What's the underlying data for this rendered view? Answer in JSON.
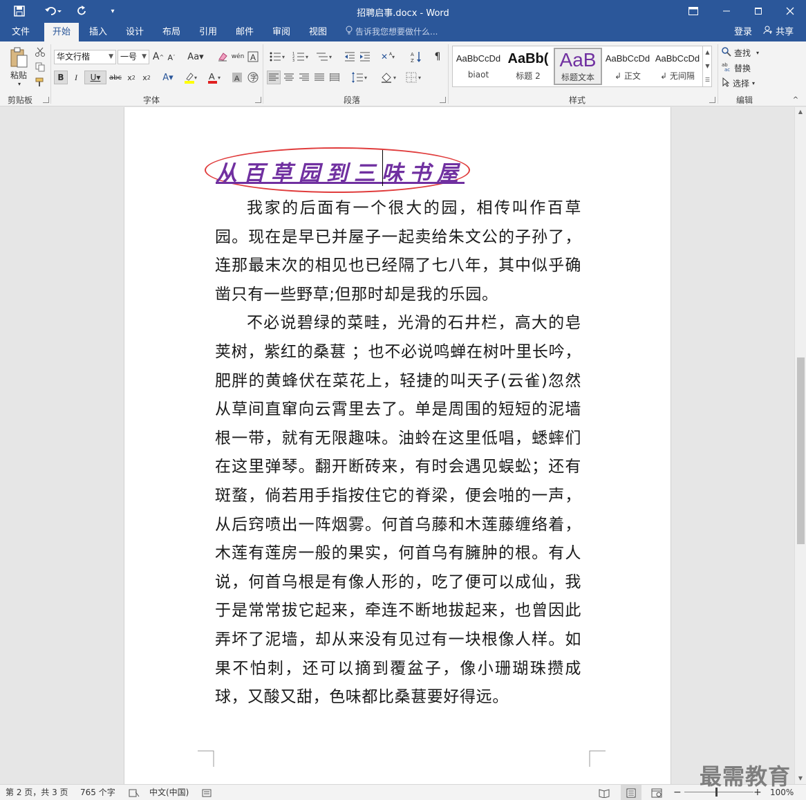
{
  "window": {
    "title": "招聘启事.docx - Word"
  },
  "tabs": [
    {
      "label": "文件"
    },
    {
      "label": "开始",
      "active": true
    },
    {
      "label": "插入"
    },
    {
      "label": "设计"
    },
    {
      "label": "布局"
    },
    {
      "label": "引用"
    },
    {
      "label": "邮件"
    },
    {
      "label": "审阅"
    },
    {
      "label": "视图"
    }
  ],
  "tellme": "告诉我您想要做什么...",
  "account": {
    "login": "登录",
    "share": "共享"
  },
  "ribbon": {
    "clipboard": {
      "paste": "粘贴",
      "label": "剪贴板"
    },
    "font": {
      "name": "华文行楷",
      "size": "一号",
      "label": "字体"
    },
    "paragraph": {
      "label": "段落"
    },
    "styles": {
      "label": "样式",
      "items": [
        {
          "preview": "AaBbCcDd",
          "name": "biaot"
        },
        {
          "preview": "AaBb(",
          "name": "标题 2"
        },
        {
          "preview": "AaB",
          "name": "标题文本"
        },
        {
          "preview": "AaBbCcDd",
          "name": "正文"
        },
        {
          "preview": "AaBbCcDd",
          "name": "无间隔"
        }
      ]
    },
    "editing": {
      "find": "查找",
      "replace": "替换",
      "select": "选择",
      "label": "编辑"
    }
  },
  "document": {
    "title": "从百草园到三味书屋",
    "paragraphs": [
      "我家的后面有一个很大的园，相传叫作百草园。现在是早已并屋子一起卖给朱文公的子孙了，连那最末次的相见也已经隔了七八年，其中似乎确凿只有一些野草;但那时却是我的乐园。",
      "不必说碧绿的菜畦，光滑的石井栏，高大的皂荚树，紫红的桑葚 ；也不必说鸣蝉在树叶里长吟，肥胖的黄蜂伏在菜花上，轻捷的叫天子(云雀)忽然从草间直窜向云霄里去了。单是周围的短短的泥墙根一带，就有无限趣味。油蛉在这里低唱，蟋蟀们在这里弹琴。翻开断砖来，有时会遇见蜈蚣；还有斑蝥，倘若用手指按住它的脊梁，便会啪的一声，从后窍喷出一阵烟雾。何首乌藤和木莲藤缠络着，木莲有莲房一般的果实，何首乌有臃肿的根。有人说，何首乌根是有像人形的，吃了便可以成仙，我于是常常拔它起来，牵连不断地拔起来，也曾因此弄坏了泥墙，却从来没有见过有一块根像人样。如果不怕刺，还可以摘到覆盆子，像小珊瑚珠攒成球，又酸又甜，色味都比桑葚要好得远。"
    ]
  },
  "status": {
    "page": "第 2 页，共 3 页",
    "words": "765 个字",
    "language": "中文(中国)",
    "zoom": "100%",
    "zoom_level": 100
  },
  "watermark": "最需教育",
  "colors": {
    "titlebar": "#2b579a",
    "title_text": "#7030a0",
    "ellipse": "#e03c3c"
  }
}
